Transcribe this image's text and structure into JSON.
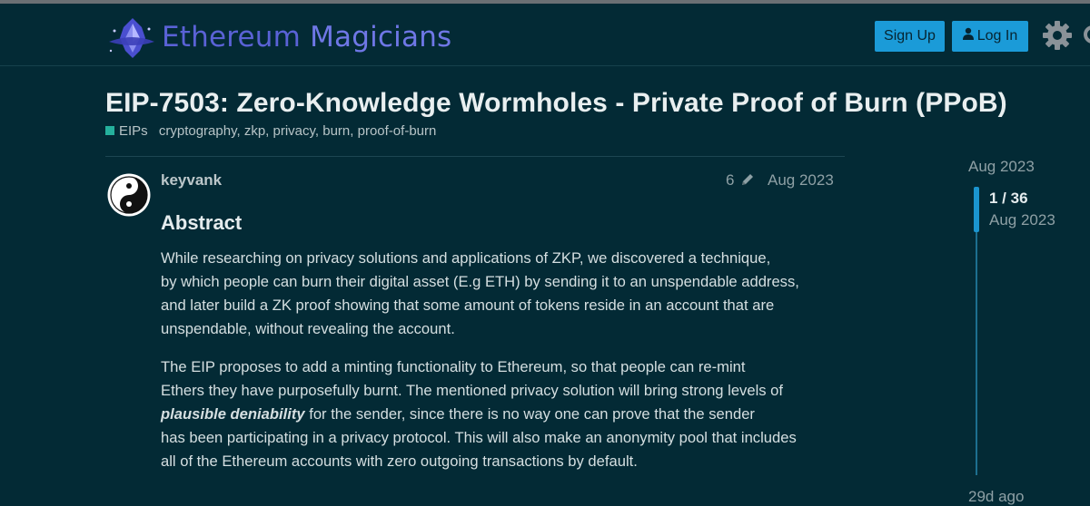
{
  "header": {
    "logo_word1": "Ethereum",
    "logo_word2": "Magicians",
    "signup_label": "Sign Up",
    "login_label": "Log In",
    "login_icon": "user-icon",
    "settings_icon": "gear-icon"
  },
  "topic": {
    "title": "EIP-7503: Zero-Knowledge Wormholes - Private Proof of Burn (PPoB)",
    "category": "EIPs",
    "category_color": "#25b09c",
    "tags": [
      "cryptography",
      "zkp",
      "privacy",
      "burn",
      "proof-of-burn"
    ],
    "tag_separators": [
      ",",
      ",",
      ",",
      ","
    ]
  },
  "post": {
    "username": "keyvank",
    "edit_count": "6",
    "date": "Aug 2023",
    "heading": "Abstract",
    "para1": [
      "While researching on privacy solutions and applications of ZKP, we discovered a technique,",
      "by which people can burn their digital asset (E.g ETH) by sending it to an unspendable address,",
      "and later build a ZK proof showing that some amount of tokens reside in an account that are",
      "unspendable, without revealing the account."
    ],
    "para2": {
      "line1": "The EIP proposes to add a minting functionality to Ethereum, so that people can re-mint",
      "line2": "Ethers they have purposefully burnt. The mentioned privacy solution will bring strong levels of",
      "line3_emph": "plausible deniability",
      "line3_rest": " for the sender, since there is no way one can prove that the sender",
      "line4": "has been participating in a privacy protocol. This will also make an anonymity pool that includes",
      "line5": "all of the Ethereum accounts with zero outgoing transactions by default."
    }
  },
  "timeline": {
    "start_date": "Aug 2023",
    "position": "1 / 36",
    "current_date": "Aug 2023",
    "end_label": "29d ago"
  },
  "colors": {
    "background": "#032a35",
    "accent": "#1b9bd8"
  }
}
